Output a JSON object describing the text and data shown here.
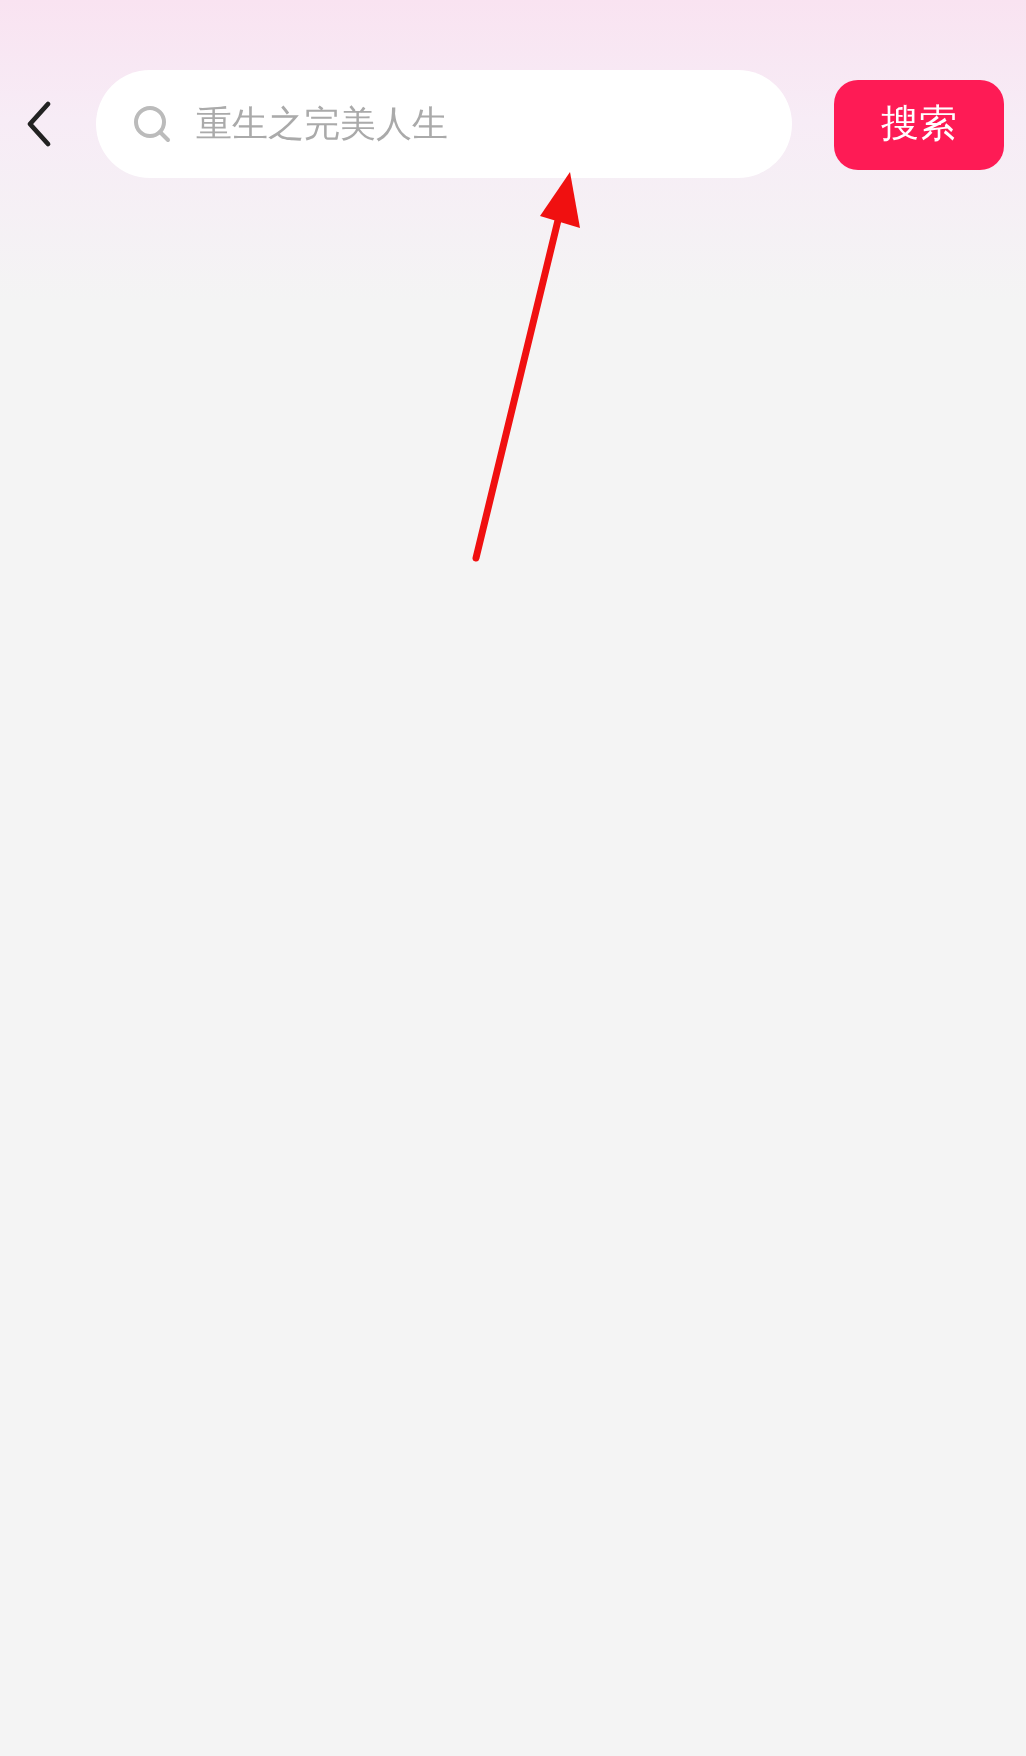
{
  "search": {
    "placeholder": "重生之完美人生"
  },
  "search_button": {
    "label": "搜索"
  },
  "annotation": {
    "kind": "arrow"
  }
}
